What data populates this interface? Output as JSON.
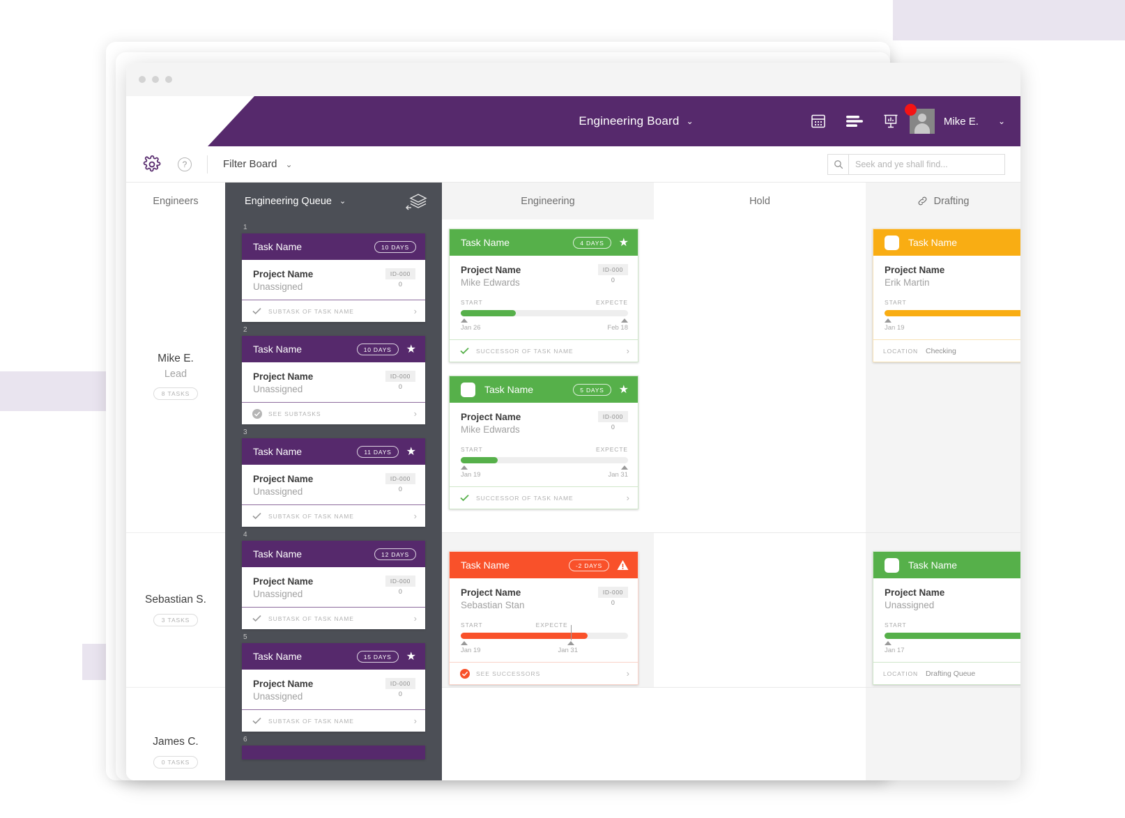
{
  "window": {
    "title_dots": 3
  },
  "header": {
    "board_title": "Engineering Board",
    "caret": "⌄",
    "icons": [
      {
        "name": "calendar-icon"
      },
      {
        "name": "list-view-icon"
      },
      {
        "name": "presentation-chart-icon"
      }
    ],
    "user_name": "Mike E.",
    "user_caret": "⌄",
    "purple": "#56296c",
    "notification": true
  },
  "toolbar": {
    "gear_label": "settings",
    "help_label": "?",
    "filter_label": "Filter Board",
    "filter_caret": "⌄",
    "search_placeholder": "Seek and ye shall find...",
    "search_value": ""
  },
  "columns": [
    {
      "key": "engineers",
      "label": "Engineers"
    },
    {
      "key": "queue",
      "label": "Engineering Queue",
      "caret": "⌄",
      "active": true
    },
    {
      "key": "engineering",
      "label": "Engineering"
    },
    {
      "key": "hold",
      "label": "Hold"
    },
    {
      "key": "drafting",
      "label": "Drafting",
      "icon": "link-icon"
    }
  ],
  "engineers": [
    {
      "name": "Mike E.",
      "role": "Lead",
      "tasks": "8 TASKS"
    },
    {
      "name": "Sebastian S.",
      "role": "",
      "tasks": "3 TASKS"
    },
    {
      "name": "James C.",
      "role": "",
      "tasks": "0 TASKS"
    }
  ],
  "queue_cards": [
    {
      "num": "1",
      "title": "Task Name",
      "days": "10 DAYS",
      "star": false,
      "checkbox": false,
      "project": "Project Name",
      "assignee": "Unassigned",
      "id": "ID-000",
      "idnum": "0",
      "footer": "SUBTASK OF TASK NAME",
      "footer_icon": "check-icon",
      "color": "#56296c"
    },
    {
      "num": "2",
      "title": "Task Name",
      "days": "10 DAYS",
      "star": true,
      "checkbox": false,
      "project": "Project Name",
      "assignee": "Unassigned",
      "id": "ID-000",
      "idnum": "0",
      "footer": "SEE SUBTASKS",
      "footer_icon": "check-circle-icon",
      "color": "#56296c"
    },
    {
      "num": "3",
      "title": "Task Name",
      "days": "11 DAYS",
      "star": true,
      "checkbox": false,
      "project": "Project Name",
      "assignee": "Unassigned",
      "id": "ID-000",
      "idnum": "0",
      "footer": "SUBTASK OF TASK NAME",
      "footer_icon": "check-icon",
      "color": "#56296c"
    },
    {
      "num": "4",
      "title": "Task Name",
      "days": "12 DAYS",
      "star": false,
      "checkbox": false,
      "project": "Project Name",
      "assignee": "Unassigned",
      "id": "ID-000",
      "idnum": "0",
      "footer": "SUBTASK OF TASK NAME",
      "footer_icon": "check-icon",
      "color": "#56296c"
    },
    {
      "num": "5",
      "title": "Task Name",
      "days": "15 DAYS",
      "star": true,
      "checkbox": false,
      "project": "Project Name",
      "assignee": "Unassigned",
      "id": "ID-000",
      "idnum": "0",
      "footer": "SUBTASK OF TASK NAME",
      "footer_icon": "check-icon",
      "color": "#56296c"
    },
    {
      "num": "6",
      "title": "",
      "days": "",
      "star": false,
      "checkbox": false,
      "project": "",
      "assignee": "",
      "id": "",
      "idnum": "",
      "footer": "",
      "footer_icon": "",
      "color": "#56296c"
    }
  ],
  "engineering_cards": [
    {
      "title": "Task Name",
      "days": "4 DAYS",
      "star": true,
      "checkbox": false,
      "warn": false,
      "project": "Project Name",
      "assignee": "Mike Edwards",
      "id": "ID-000",
      "idnum": "0",
      "start_label": "START",
      "end_label": "EXPECTE",
      "start_date": "Jan 26",
      "end_date": "Feb 18",
      "progress": 33,
      "footer": "SUCCESSOR OF TASK NAME",
      "footer_icon": "check-icon",
      "color": "#56b04a"
    },
    {
      "title": "Task Name",
      "days": "5 DAYS",
      "star": true,
      "checkbox": true,
      "warn": false,
      "project": "Project Name",
      "assignee": "Mike Edwards",
      "id": "ID-000",
      "idnum": "0",
      "start_label": "START",
      "end_label": "EXPECTE",
      "start_date": "Jan 19",
      "end_date": "Jan 31",
      "progress": 22,
      "footer": "SUCCESSOR OF TASK NAME",
      "footer_icon": "check-icon",
      "color": "#56b04a"
    },
    {
      "title": "Task Name",
      "days": "-2 DAYS",
      "star": false,
      "checkbox": false,
      "warn": true,
      "project": "Project Name",
      "assignee": "Sebastian Stan",
      "id": "ID-000",
      "idnum": "0",
      "start_label": "START",
      "end_label": "EXPECTE",
      "start_date": "Jan 19",
      "end_date": "Jan 31",
      "progress": 76,
      "footer": "SEE SUCCESSORS",
      "footer_icon": "check-circle-icon",
      "color": "#f9512a"
    }
  ],
  "drafting_cards": [
    {
      "title": "Task Name",
      "checkbox": true,
      "project": "Project Name",
      "assignee": "Erik Martin",
      "start_label": "START",
      "start_date": "Jan 19",
      "progress": 100,
      "loc_label": "LOCATION",
      "loc_value": "Checking",
      "color": "#f9ad13"
    },
    {
      "title": "Task Name",
      "checkbox": true,
      "project": "Project Name",
      "assignee": "Unassigned",
      "start_label": "START",
      "start_date": "Jan 17",
      "progress": 100,
      "loc_label": "LOCATION",
      "loc_value": "Drafting Queue",
      "color": "#56b04a"
    }
  ],
  "colors": {
    "purple": "#56296c",
    "green": "#56b04a",
    "orange": "#f9512a",
    "amber": "#f9ad13",
    "dark_panel": "#4c4f56",
    "notification_red": "#f51414"
  }
}
